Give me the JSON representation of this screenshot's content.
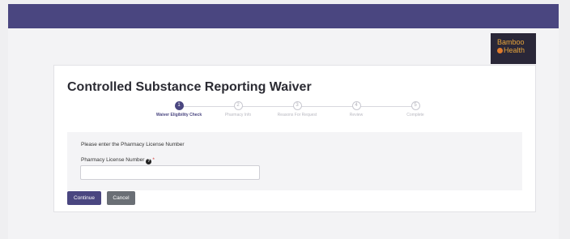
{
  "logo": {
    "line1": "Bamboo",
    "line2": "Health"
  },
  "page": {
    "title": "Controlled Substance Reporting Waiver"
  },
  "stepper": {
    "steps": [
      {
        "number": "1",
        "label": "Waiver Eligibility Check",
        "active": true
      },
      {
        "number": "2",
        "label": "Pharmacy Info",
        "active": false
      },
      {
        "number": "3",
        "label": "Reasons For Request",
        "active": false
      },
      {
        "number": "4",
        "label": "Review",
        "active": false
      },
      {
        "number": "5",
        "label": "Complete",
        "active": false
      }
    ]
  },
  "form": {
    "prompt": "Please enter the Pharmacy License Number",
    "field_label": "Pharmacy License Number",
    "help_glyph": "?",
    "required_marker": "*",
    "field_value": ""
  },
  "actions": {
    "continue_label": "Continue",
    "cancel_label": "Cancel"
  },
  "colors": {
    "brand": "#4a4680",
    "cancel": "#6a6f75",
    "logo_bg": "#2a2738",
    "logo_text": "#e8a53a"
  },
  "icons": {
    "help": "question-circle-icon",
    "logo_mark": "bamboo-dot-icon"
  }
}
